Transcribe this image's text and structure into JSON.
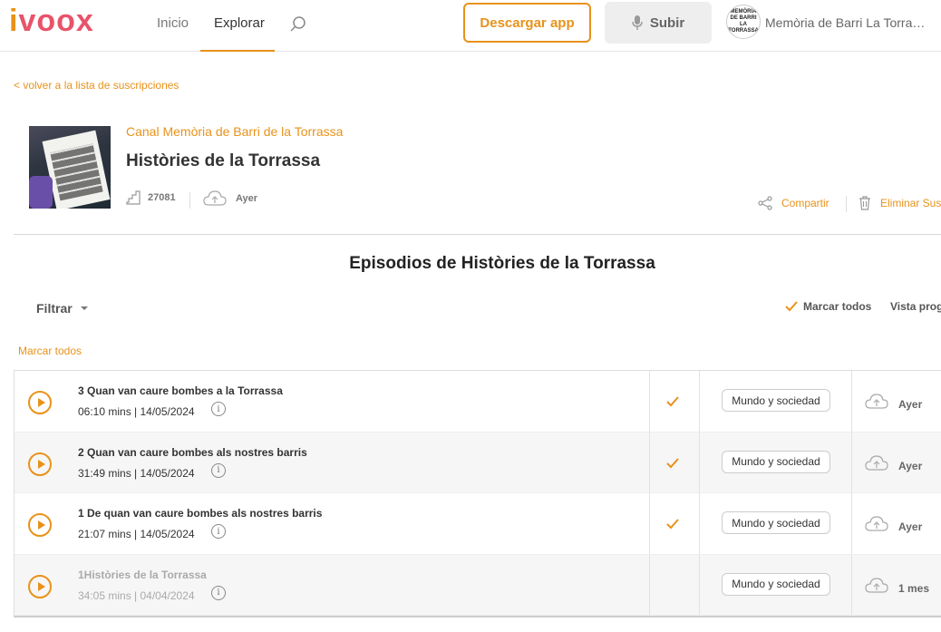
{
  "header": {
    "logo": "ivoox",
    "nav": [
      "Inicio",
      "Explorar"
    ],
    "download_label": "Descargar app",
    "upload_label": "Subir",
    "user_name": "Memòria de Barri La Torrassa",
    "avatar_text": "MEMÒRIA DE BARRI LA TORRASSA"
  },
  "back_link": "< volver a la lista de suscripciones",
  "channel": {
    "label": "Canal Memòria de Barri de la Torrassa",
    "title": "Històries de la Torrassa",
    "count": "27081",
    "date": "Ayer",
    "share_label": "Compartir",
    "delete_label": "Eliminar Suscripción"
  },
  "section_title": "Episodios de Històries de la Torrassa",
  "toolbar": {
    "filter_label": "Filtrar",
    "mark_all_label": "Marcar todos",
    "view_label": "Vista prog",
    "mark_all_left": "Marcar todos"
  },
  "episodes": [
    {
      "title": "3 Quan van caure bombes a la Torrassa",
      "meta": "06:10 mins | 14/05/2024",
      "checked": true,
      "category": "Mundo y sociedad",
      "when": "Ayer"
    },
    {
      "title": "2 Quan van caure bombes als nostres barris",
      "meta": "31:49 mins | 14/05/2024",
      "checked": true,
      "category": "Mundo y sociedad",
      "when": "Ayer"
    },
    {
      "title": "1 De quan van caure bombes als nostres barris",
      "meta": "21:07 mins | 14/05/2024",
      "checked": true,
      "category": "Mundo y sociedad",
      "when": "Ayer"
    },
    {
      "title": "1Històries de la Torrassa",
      "meta": "34:05 mins | 04/04/2024",
      "checked": false,
      "category": "Mundo y sociedad",
      "when": "1 mes"
    }
  ],
  "colors": {
    "accent": "#e8921a",
    "logo": "#e8536a"
  },
  "icons": [
    "search-icon",
    "mic-icon",
    "stairs-icon",
    "cloud-upload-icon",
    "share-icon",
    "trash-icon",
    "chevron-down-icon",
    "check-icon",
    "play-icon",
    "info-icon"
  ]
}
